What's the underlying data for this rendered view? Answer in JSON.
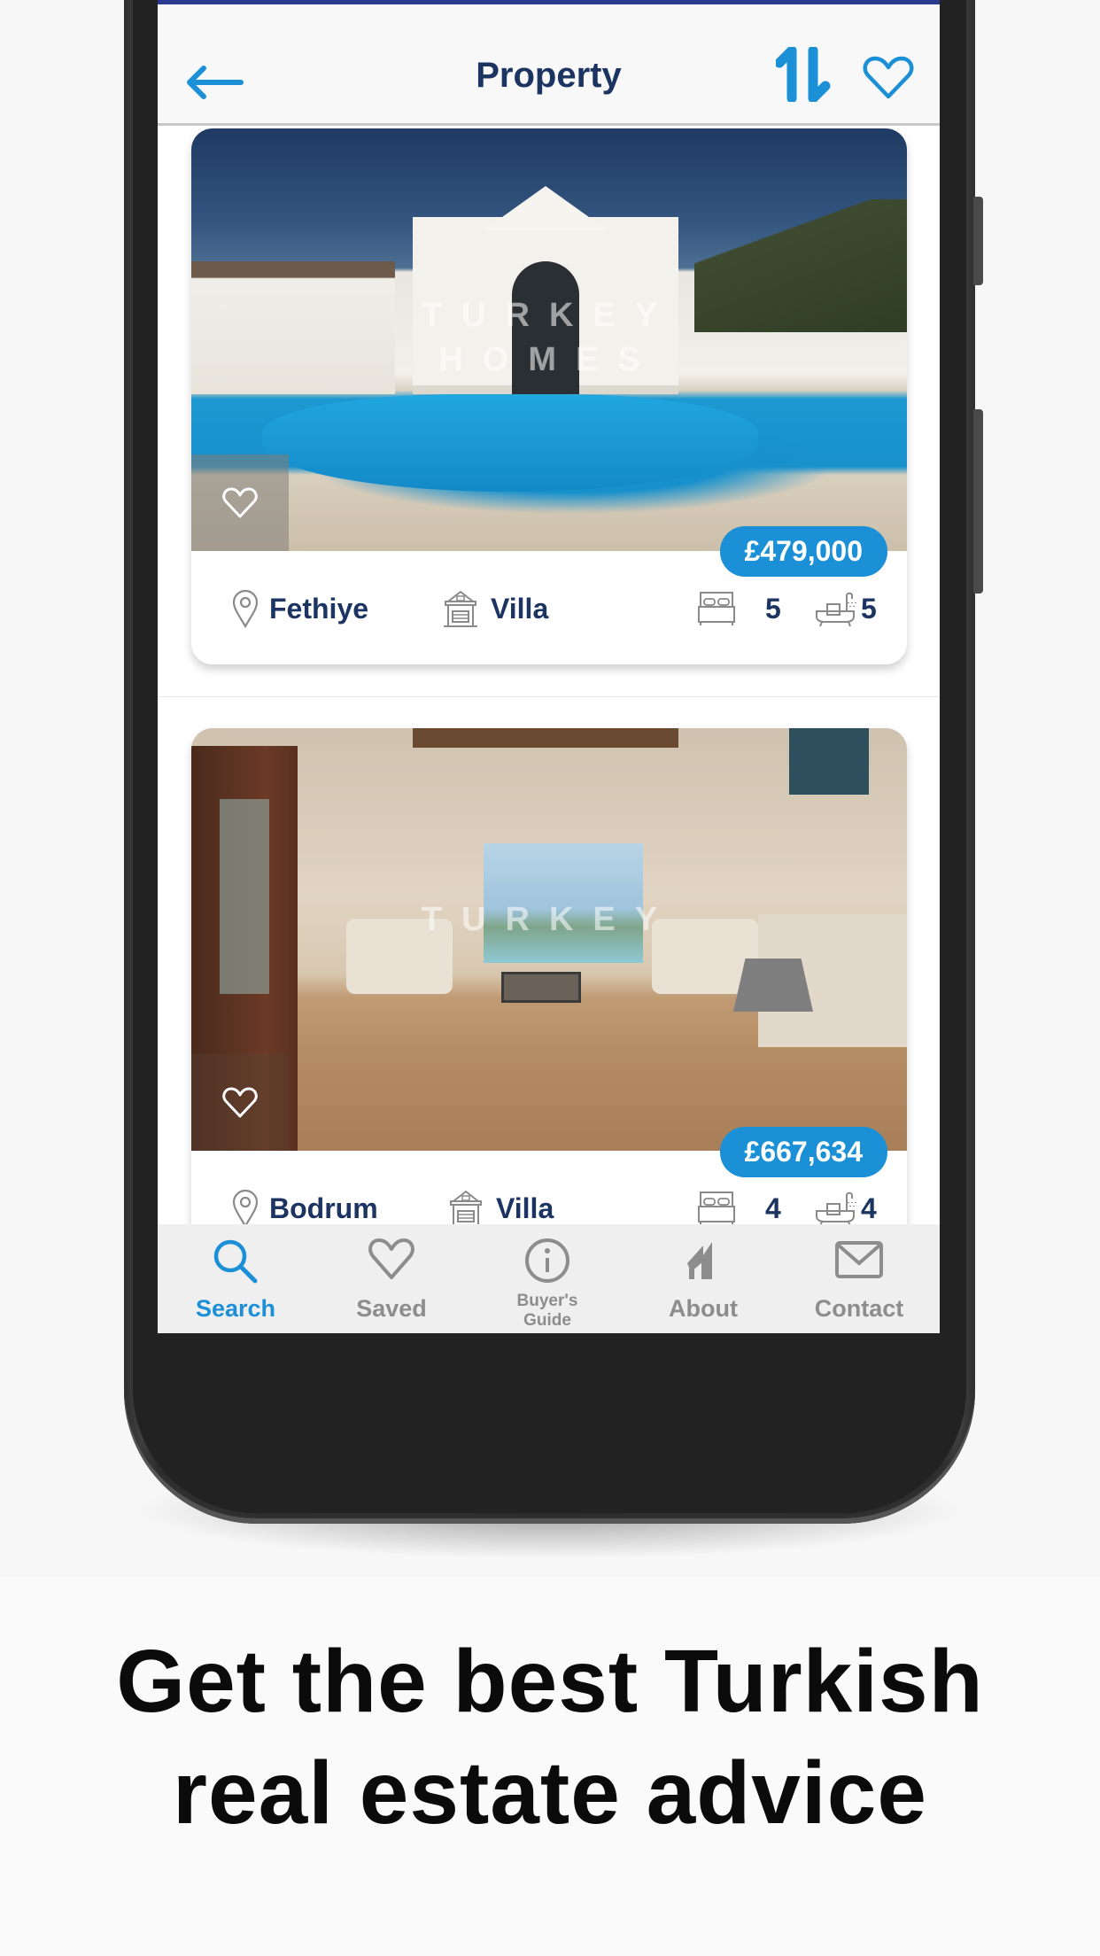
{
  "header": {
    "title": "Property",
    "back_icon": "arrow-left-icon",
    "sort_icon": "sort-up-down-icon",
    "favorites_icon": "heart-outline-icon"
  },
  "colors": {
    "accent": "#1b90d7",
    "navy_text": "#1c3461",
    "status_bar": "#2b3990",
    "inactive_tab": "#8d8d8d"
  },
  "listings": [
    {
      "price": "£479,000",
      "location": "Fethiye",
      "type": "Villa",
      "bedrooms": "5",
      "bathrooms": "5",
      "watermark_top": "TURKEY",
      "watermark_bottom": "HOMES",
      "favorite_icon": "heart-outline-icon"
    },
    {
      "price": "£667,634",
      "location": "Bodrum",
      "type": "Villa",
      "bedrooms": "4",
      "bathrooms": "4",
      "watermark_top": "TURKEY",
      "watermark_bottom": "",
      "favorite_icon": "heart-outline-icon"
    }
  ],
  "tabbar": {
    "active": "Search",
    "items": [
      {
        "label": "Search",
        "icon": "search-icon"
      },
      {
        "label": "Saved",
        "icon": "heart-outline-icon"
      },
      {
        "label": "Buyer's Guide",
        "icon": "info-circle-icon"
      },
      {
        "label": "About",
        "icon": "turkey-homes-logo-icon"
      },
      {
        "label": "Contact",
        "icon": "envelope-icon"
      }
    ]
  },
  "caption": {
    "line1": "Get the best Turkish",
    "line2": "real estate advice"
  }
}
